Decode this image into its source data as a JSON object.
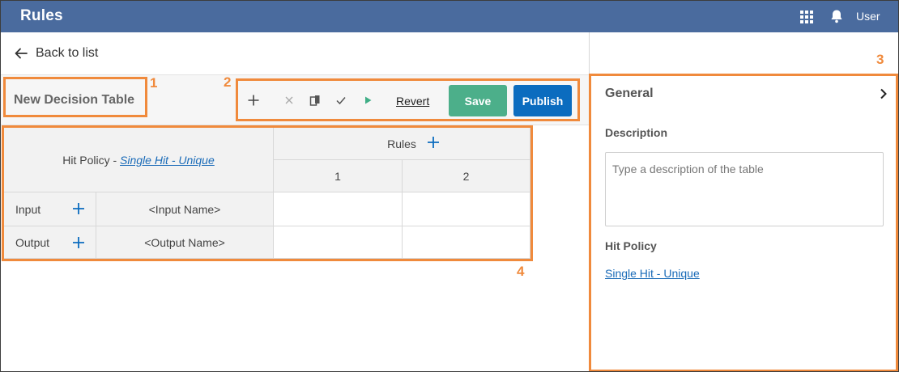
{
  "header": {
    "app_title": "Rules",
    "apps_icon": "apps-grid-icon",
    "notifications_icon": "bell-icon",
    "user_label": "User",
    "color": "#4a6b9e"
  },
  "nav": {
    "back_label": "Back to list",
    "back_icon": "arrow-left-icon"
  },
  "table_header": {
    "name": "New Decision Table"
  },
  "toolbar": {
    "icons": [
      "plus-icon",
      "close-icon",
      "clipboard-icon",
      "check-icon",
      "play-icon"
    ],
    "revert_label": "Revert",
    "save_label": "Save",
    "publish_label": "Publish",
    "save_color": "#4caf8a",
    "publish_color": "#0b6cbf"
  },
  "decision_table": {
    "hit_policy_label": "Hit Policy - ",
    "hit_policy_value": "Single Hit - Unique",
    "rules_label": "Rules",
    "rule_columns": [
      "1",
      "2"
    ],
    "input_label": "Input",
    "input_name": "<Input Name>",
    "output_label": "Output",
    "output_name": "<Output Name>"
  },
  "panel": {
    "title": "General",
    "description_label": "Description",
    "description_value": "",
    "description_placeholder": "Type a description of the table",
    "hit_policy_label": "Hit Policy",
    "hit_policy_value": "Single Hit - Unique"
  },
  "callouts": {
    "color": "#f08a3c",
    "labels": [
      "1",
      "2",
      "3",
      "4"
    ]
  }
}
